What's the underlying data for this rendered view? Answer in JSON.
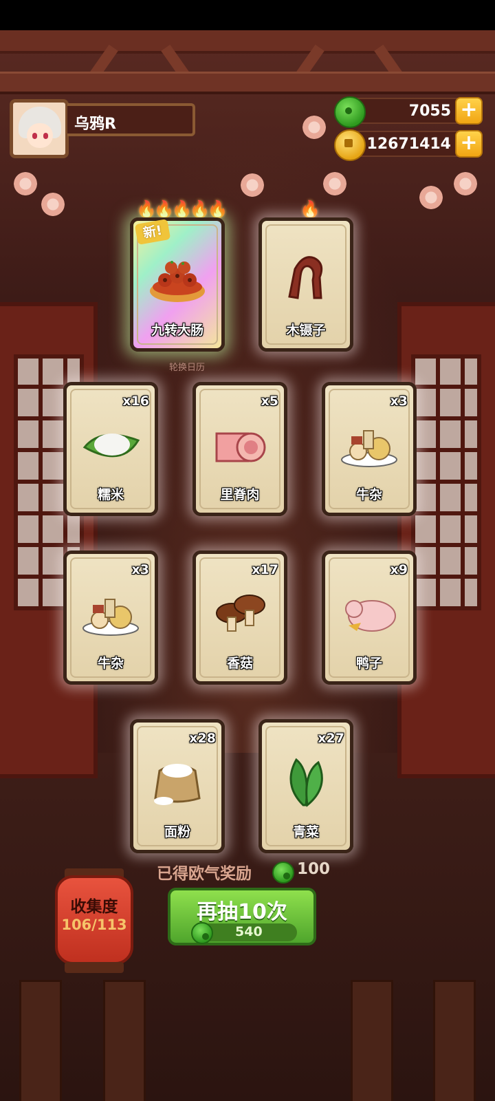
{
  "player": {
    "name": "乌鸦R"
  },
  "currency": {
    "jade": {
      "icon": "jade-icon",
      "value": "7055"
    },
    "coins": {
      "icon": "coin-icon",
      "value": "12671414"
    }
  },
  "featured": [
    {
      "name": "九转大肠",
      "stars": 5,
      "flames": "🔥🔥🔥🔥🔥",
      "badge": "新!",
      "rarity": "rainbow"
    },
    {
      "name": "木镊子",
      "stars": 1,
      "flames": "🔥"
    }
  ],
  "calendar_label": "轮换日历",
  "cards": [
    {
      "name": "糯米",
      "count": "x16"
    },
    {
      "name": "里脊肉",
      "count": "x5"
    },
    {
      "name": "牛杂",
      "count": "x3"
    },
    {
      "name": "牛杂",
      "count": "x3"
    },
    {
      "name": "香菇",
      "count": "x17"
    },
    {
      "name": "鸭子",
      "count": "x9"
    },
    {
      "name": "面粉",
      "count": "x28"
    },
    {
      "name": "青菜",
      "count": "x27"
    }
  ],
  "reward": {
    "label": "已得欧气奖励",
    "value": "100"
  },
  "draw_button": {
    "label": "再抽10次",
    "cost": "540"
  },
  "collection": {
    "title": "收集度",
    "value": "106/113"
  },
  "colors": {
    "accent_green": "#4fa52c",
    "gold": "#f1a513",
    "frame": "#3a2418"
  }
}
